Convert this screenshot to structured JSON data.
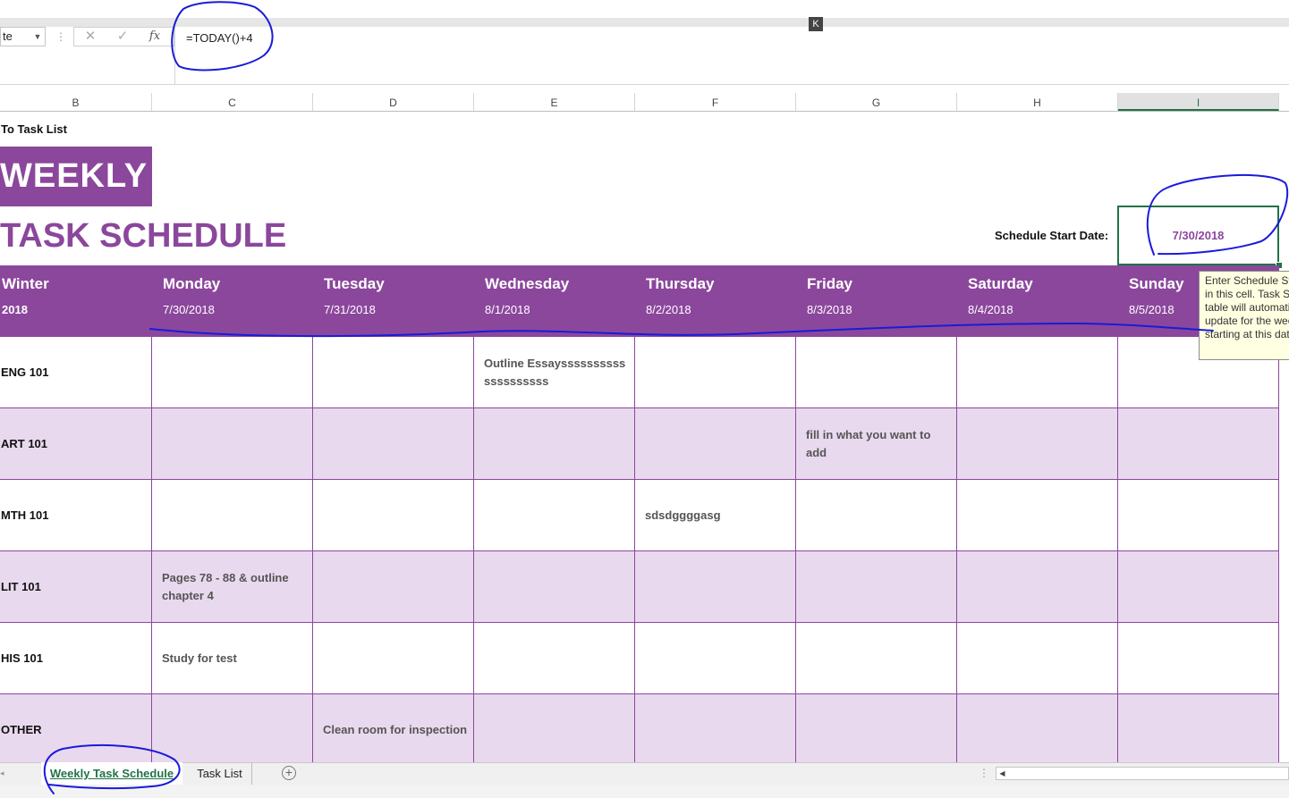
{
  "formula_bar": {
    "name_box": "te",
    "cancel_icon": "✕",
    "enter_icon": "✓",
    "fx_label": "fx",
    "formula": "=TODAY()+4",
    "k_button": "K"
  },
  "columns": [
    "B",
    "C",
    "D",
    "E",
    "F",
    "G",
    "H",
    "I"
  ],
  "selected_column": "I",
  "sheet": {
    "back_link": "To Task List",
    "title_line1": "WEEKLY",
    "title_line2": "TASK SCHEDULE",
    "start_date_label": "Schedule Start Date:",
    "start_date_value": "7/30/2018",
    "tooltip": [
      "Enter Schedule Start Date",
      "in this cell. Task Schedule",
      "table will automatically",
      "update for the week",
      "starting at this date."
    ]
  },
  "header": {
    "term": "Winter",
    "year": "2018",
    "days": [
      {
        "name": "Monday",
        "date": "7/30/2018"
      },
      {
        "name": "Tuesday",
        "date": "7/31/2018"
      },
      {
        "name": "Wednesday",
        "date": "8/1/2018"
      },
      {
        "name": "Thursday",
        "date": "8/2/2018"
      },
      {
        "name": "Friday",
        "date": "8/3/2018"
      },
      {
        "name": "Saturday",
        "date": "8/4/2018"
      },
      {
        "name": "Sunday",
        "date": "8/5/2018"
      }
    ]
  },
  "rows": [
    {
      "label": "ENG 101",
      "cells": [
        "",
        "",
        "Outline Essayssssssssssssssssssss",
        "",
        "",
        "",
        ""
      ]
    },
    {
      "label": "ART 101",
      "cells": [
        "",
        "",
        "",
        "",
        "fill in what you want to add",
        "",
        ""
      ]
    },
    {
      "label": "MTH 101",
      "cells": [
        "",
        "",
        "",
        "sdsdggggasg",
        "",
        "",
        ""
      ]
    },
    {
      "label": "LIT 101",
      "cells": [
        "Pages 78 - 88 & outline chapter 4",
        "",
        "",
        "",
        "",
        "",
        ""
      ]
    },
    {
      "label": "HIS 101",
      "cells": [
        "Study for test",
        "",
        "",
        "",
        "",
        "",
        ""
      ]
    },
    {
      "label": "OTHER",
      "cells": [
        "",
        "Clean room for inspection",
        "",
        "",
        "",
        "",
        ""
      ]
    }
  ],
  "tabs": {
    "active": "Weekly Task Schedule",
    "other": "Task List",
    "add_icon": "+"
  },
  "colors": {
    "accent_purple": "#8b479c",
    "light_purple": "#e9d9ee",
    "excel_green": "#217346",
    "ink_blue": "#1a1adb"
  }
}
